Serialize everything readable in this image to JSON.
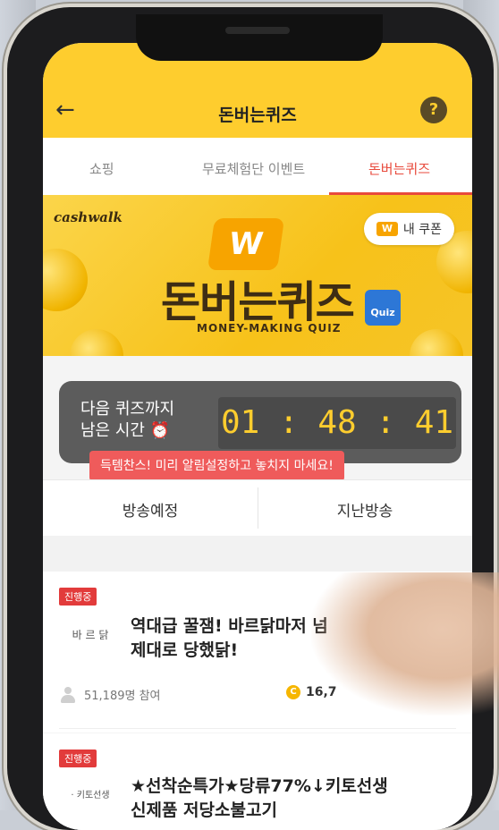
{
  "header": {
    "title": "돈버는퀴즈",
    "back_icon": "←",
    "help_icon": "?"
  },
  "tabs": [
    {
      "label": "쇼핑"
    },
    {
      "label": "무료체험단 이벤트"
    },
    {
      "label": "돈버는퀴즈",
      "active": true
    }
  ],
  "banner": {
    "brand": "cashwalk",
    "coupon_label": "내 쿠폰",
    "coupon_icon": "W",
    "logo": "W",
    "title": "돈버는퀴즈",
    "subtitle": "MONEY-MAKING QUIZ",
    "box_label": "Quiz"
  },
  "timer": {
    "label_line1": "다음 퀴즈까지",
    "label_line2": "남은 시간 ⏰",
    "value": "01 : 48 : 41"
  },
  "tip": "득템찬스! 미리 알림설정하고 놓치지 마세요!",
  "subtabs": [
    {
      "label": "방송예정"
    },
    {
      "label": "지난방송"
    }
  ],
  "quizzes": [
    {
      "badge": "진행중",
      "thumb": "바 르 닭",
      "title_line1": "역대급 꿀잼! 바르닭마저 넘",
      "title_line2": "제대로 당했닭!",
      "participants": "51,189명 참여",
      "reward": "16,7"
    },
    {
      "badge": "진행중",
      "thumb": "· 키토선생",
      "title_line1": "★선착순특가★당류77%↓키토선생",
      "title_line2": "신제품 저당소불고기"
    }
  ],
  "colors": {
    "header": "#fecd2e",
    "accent": "#e84a3c",
    "timer_digits": "#fecd2e"
  }
}
